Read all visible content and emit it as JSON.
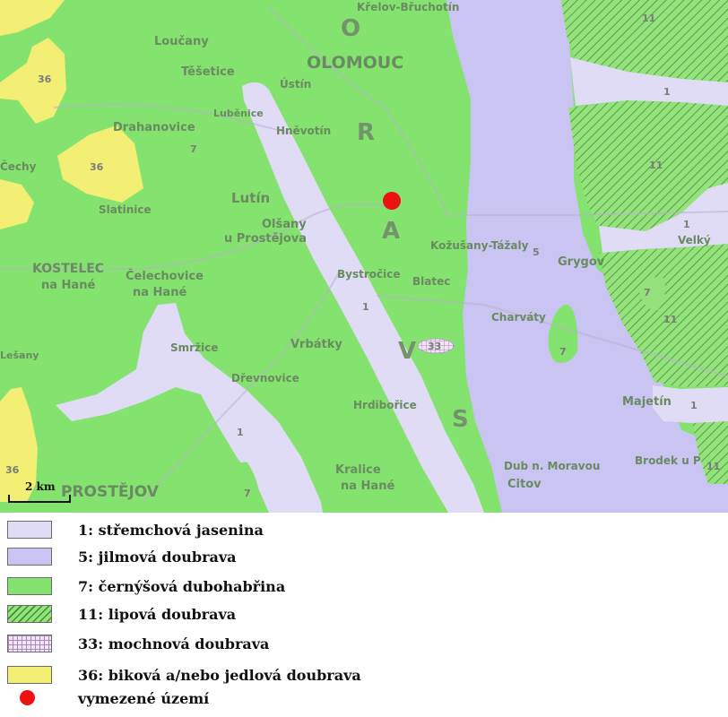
{
  "map": {
    "city_main": "OLOMOUC",
    "city_south": "PROSTĚJOV",
    "region_letters": [
      "O",
      "R",
      "A",
      "V",
      "S"
    ],
    "places": [
      {
        "id": "krelov",
        "text": "Křelov-Břuchotín"
      },
      {
        "id": "loucany",
        "text": "Loučany"
      },
      {
        "id": "tesetice",
        "text": "Těšetice"
      },
      {
        "id": "ustin",
        "text": "Ústín"
      },
      {
        "id": "drahanovice",
        "text": "Drahanovice"
      },
      {
        "id": "lubenice",
        "text": "Luběnice"
      },
      {
        "id": "hnevotin",
        "text": "Hněvotín"
      },
      {
        "id": "lutin",
        "text": "Lutín"
      },
      {
        "id": "olsany",
        "text": "Olšany"
      },
      {
        "id": "olsany2",
        "text": "u Prostějova"
      },
      {
        "id": "slatinice",
        "text": "Slatinice"
      },
      {
        "id": "kostelec",
        "text": "KOSTELEC"
      },
      {
        "id": "kostelec2",
        "text": "na Hané"
      },
      {
        "id": "celechovice",
        "text": "Čelechovice"
      },
      {
        "id": "celechovice2",
        "text": "na Hané"
      },
      {
        "id": "bystrocice",
        "text": "Bystročice"
      },
      {
        "id": "blatec",
        "text": "Blatec"
      },
      {
        "id": "kozusany",
        "text": "Kožušany-Tážaly"
      },
      {
        "id": "grygov",
        "text": "Grygov"
      },
      {
        "id": "velky",
        "text": "Velký"
      },
      {
        "id": "vrbatky",
        "text": "Vrbátky"
      },
      {
        "id": "smrzice",
        "text": "Smržice"
      },
      {
        "id": "drevnovice",
        "text": "Dřevnovice"
      },
      {
        "id": "hrdibor",
        "text": "Hrdibořice"
      },
      {
        "id": "kralice",
        "text": "Kralice"
      },
      {
        "id": "kralice2",
        "text": "na Hané"
      },
      {
        "id": "charvaty",
        "text": "Charváty"
      },
      {
        "id": "majetin",
        "text": "Majetín"
      },
      {
        "id": "citov",
        "text": "Citov"
      },
      {
        "id": "dub",
        "text": "Dub n. Moravou"
      },
      {
        "id": "brodek",
        "text": "Brodek u P"
      },
      {
        "id": "lesany",
        "text": "Lešany"
      },
      {
        "id": "cechy",
        "text": "Čechy"
      }
    ],
    "unit_labels": [
      {
        "id": "u36a",
        "text": "36"
      },
      {
        "id": "u36b",
        "text": "36"
      },
      {
        "id": "u36c",
        "text": "36"
      },
      {
        "id": "u7a",
        "text": "7"
      },
      {
        "id": "u7b",
        "text": "7"
      },
      {
        "id": "u7c",
        "text": "7"
      },
      {
        "id": "u7d",
        "text": "7"
      },
      {
        "id": "u1a",
        "text": "1"
      },
      {
        "id": "u1b",
        "text": "1"
      },
      {
        "id": "u1c",
        "text": "1"
      },
      {
        "id": "u1d",
        "text": "1"
      },
      {
        "id": "u1e",
        "text": "1"
      },
      {
        "id": "u5",
        "text": "5"
      },
      {
        "id": "u11a",
        "text": "11"
      },
      {
        "id": "u11b",
        "text": "11"
      },
      {
        "id": "u11c",
        "text": "11"
      },
      {
        "id": "u11d",
        "text": "11"
      },
      {
        "id": "u33",
        "text": "33"
      }
    ],
    "scale_bar_label": "2 km",
    "colors": {
      "green_7": "#84e26e",
      "lavender_1": "#e1dcf6",
      "violet_5": "#c9c4f2",
      "yellow_36": "#f3ee74",
      "lime_11": "#95e27d",
      "marker": "#ee1111"
    }
  },
  "legend": {
    "items": [
      {
        "key": "u1",
        "label": "1: střemchová jasenina",
        "color": "#e1dcf6",
        "pattern": "solid"
      },
      {
        "key": "u5",
        "label": "5: jilmová doubrava",
        "color": "#c9c4f2",
        "pattern": "solid"
      },
      {
        "key": "u7",
        "label": "7: černýšová dubohabřina",
        "color": "#84e26e",
        "pattern": "solid"
      },
      {
        "key": "u11",
        "label": "11: lipová doubrava",
        "color": "#95e27d",
        "pattern": "hatch"
      },
      {
        "key": "u33",
        "label": "33: mochnová doubrava",
        "color": "#ead8f2",
        "pattern": "grid"
      },
      {
        "key": "u36",
        "label": "36: biková a/nebo jedlová doubrava",
        "color": "#f3ee74",
        "pattern": "solid"
      },
      {
        "key": "area",
        "label": "vymezené území",
        "color": "#ee1111",
        "pattern": "dot"
      }
    ]
  }
}
